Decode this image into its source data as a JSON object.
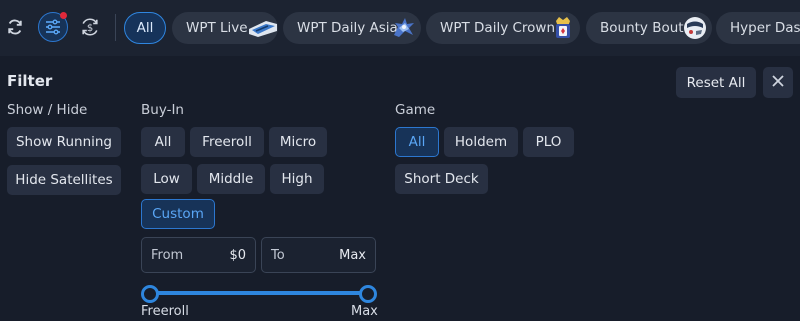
{
  "topbar": {
    "chips": [
      {
        "label": "All",
        "active": true
      },
      {
        "label": "WPT Live",
        "icon": "wpt-live-thumbnail-icon"
      },
      {
        "label": "WPT Daily Asia",
        "icon": "wpt-daily-asia-thumbnail-icon"
      },
      {
        "label": "WPT Daily Crown",
        "icon": "wpt-daily-crown-thumbnail-icon"
      },
      {
        "label": "Bounty Bout",
        "icon": "bounty-bout-thumbnail-icon"
      },
      {
        "label": "Hyper Dash"
      }
    ],
    "icons": [
      "refresh-icon",
      "filter-sliders-icon",
      "currency-exchange-icon"
    ],
    "notification_dot_color": "#e0293a"
  },
  "filter": {
    "title": "Filter",
    "reset_label": "Reset All",
    "close_icon": "close-icon",
    "show_hide": {
      "label": "Show / Hide",
      "options": [
        "Show Running",
        "Hide Satellites"
      ]
    },
    "buyin": {
      "label": "Buy-In",
      "options": [
        "All",
        "Freeroll",
        "Micro",
        "Low",
        "Middle",
        "High",
        "Custom"
      ],
      "selected": "Custom",
      "from_label": "From",
      "from_value": "$0",
      "to_label": "To",
      "to_value": "Max",
      "slider_min_label": "Freeroll",
      "slider_max_label": "Max",
      "slider_range": [
        0,
        1
      ]
    },
    "game": {
      "label": "Game",
      "options": [
        "All",
        "Holdem",
        "PLO",
        "Short Deck"
      ],
      "selected": "All"
    }
  },
  "colors": {
    "background": "#171d2a",
    "accent": "#2e86de",
    "button": "#283042"
  }
}
